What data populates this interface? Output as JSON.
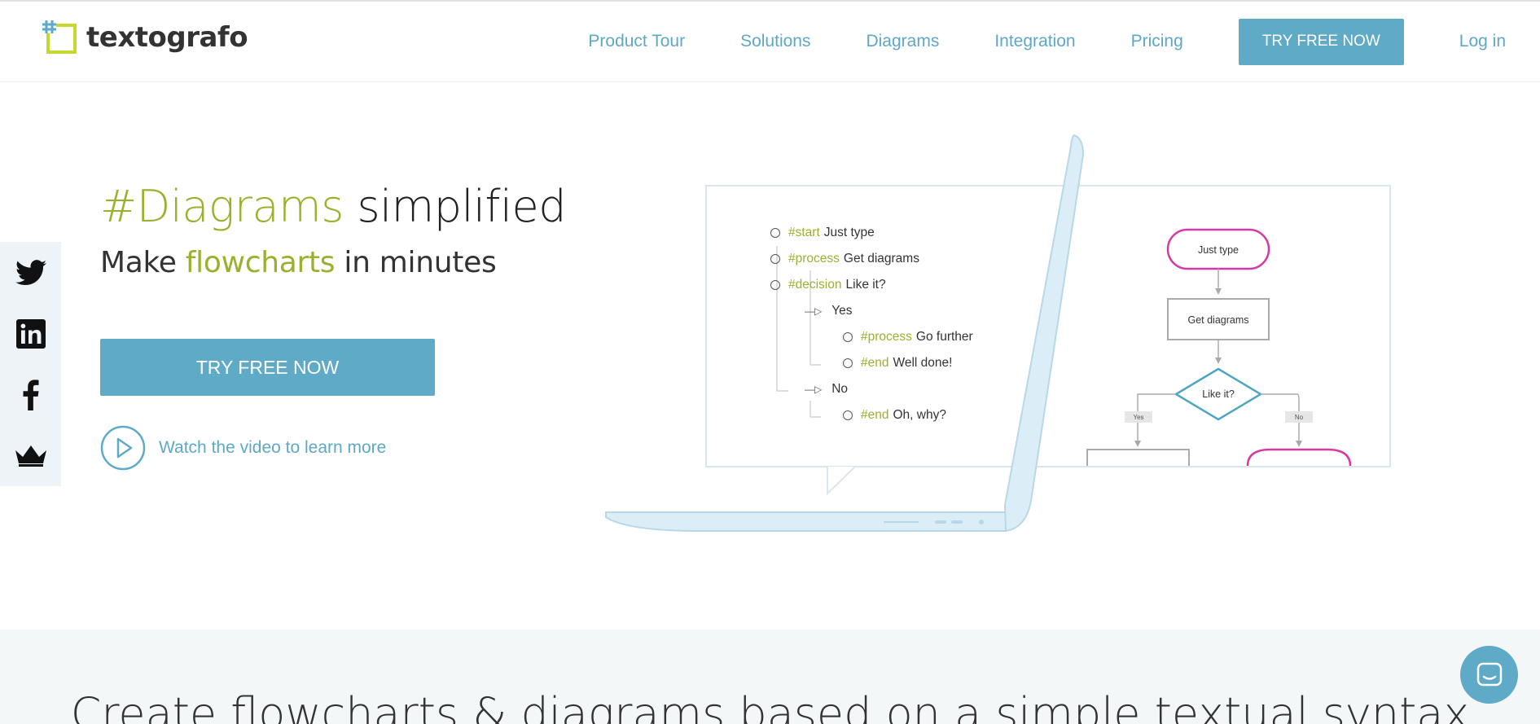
{
  "brand": {
    "name": "textografo"
  },
  "nav": {
    "items": [
      {
        "label": "Product Tour"
      },
      {
        "label": "Solutions"
      },
      {
        "label": "Diagrams"
      },
      {
        "label": "Integration"
      },
      {
        "label": "Pricing"
      }
    ],
    "cta_label": "TRY FREE NOW",
    "login_label": "Log in"
  },
  "social": {
    "icons": [
      "twitter-icon",
      "linkedin-icon",
      "facebook-icon",
      "crown-icon"
    ]
  },
  "hero": {
    "title_accent": "#Diagrams",
    "title_rest": " simplified",
    "subtitle_pre": "Make ",
    "subtitle_accent": "flowcharts",
    "subtitle_post": " in minutes",
    "cta_label": "TRY FREE NOW",
    "video_label": "Watch the video to learn more"
  },
  "illustration": {
    "list": [
      {
        "tag": "#start",
        "text": "Just type"
      },
      {
        "tag": "#process",
        "text": "Get diagrams"
      },
      {
        "tag": "#decision",
        "text": "Like it?"
      },
      {
        "branch": "Yes"
      },
      {
        "tag": "#process",
        "text": "Go further"
      },
      {
        "tag": "#end",
        "text": "Well done!"
      },
      {
        "branch": "No"
      },
      {
        "tag": "#end",
        "text": "Oh, why?"
      }
    ],
    "flow": {
      "start": "Just type",
      "process": "Get diagrams",
      "decision": "Like it?",
      "yes": "Yes",
      "no": "No"
    }
  },
  "band": {
    "title": "Create flowcharts & diagrams based on a simple textual syntax"
  },
  "colors": {
    "accent": "#99b12d",
    "brand_blue": "#5eaac7",
    "flow_pink": "#d63aa2",
    "flow_teal": "#4fa6c4"
  },
  "chat": {
    "icon": "chat-icon"
  }
}
